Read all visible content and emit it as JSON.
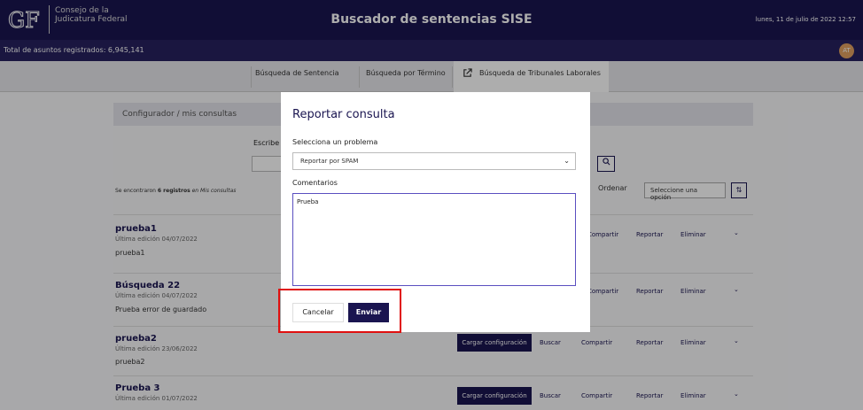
{
  "header": {
    "logo_text": "CJF",
    "org_line1": "Consejo de la",
    "org_line2": "Judicatura Federal",
    "title": "Buscador de sentencias SISE",
    "date": "lunes, 11 de julio de 2022 12:57"
  },
  "subbar": {
    "total": "Total de asuntos registrados: 6,945,141",
    "avatar": "AT"
  },
  "tabs": [
    {
      "label": "Búsqueda de Sentencia"
    },
    {
      "label": "Búsqueda por Término"
    },
    {
      "label": "Búsqueda de Tribunales Laborales",
      "icon": "external-link-icon"
    }
  ],
  "breadcrumb": {
    "root": "Configurador",
    "sep": "/",
    "current": "mis consultas"
  },
  "search": {
    "label": "Escribe"
  },
  "results": {
    "found_prefix": "Se encontraron",
    "found_count": "6 registros",
    "found_suffix": "en Mis consultas",
    "order_label": "Ordenar",
    "order_placeholder": "Seleccione una opción"
  },
  "rows": [
    {
      "title": "prueba1",
      "edit": "Última edición 04/07/2022",
      "desc": "prueba1"
    },
    {
      "title": "Búsqueda 22",
      "edit": "Última edición 04/07/2022",
      "desc": "Prueba error de guardado"
    },
    {
      "title": "prueba2",
      "edit": "Última edición 23/06/2022",
      "desc": "prueba2"
    },
    {
      "title": "Prueba 3",
      "edit": "Última edición 01/07/2022",
      "desc": ""
    }
  ],
  "row_actions": {
    "cargar": "Cargar configuración",
    "buscar": "Buscar",
    "compartir": "Compartir",
    "reportar": "Reportar",
    "eliminar": "Eliminar"
  },
  "modal": {
    "title": "Reportar consulta",
    "problem_label": "Selecciona un problema",
    "problem_value": "Reportar por SPAM",
    "comments_label": "Comentarios",
    "comments_value": "Prueba",
    "cancel": "Cancelar",
    "send": "Enviar"
  },
  "colors": {
    "primary": "#1a1550",
    "highlight": "#e01010"
  }
}
